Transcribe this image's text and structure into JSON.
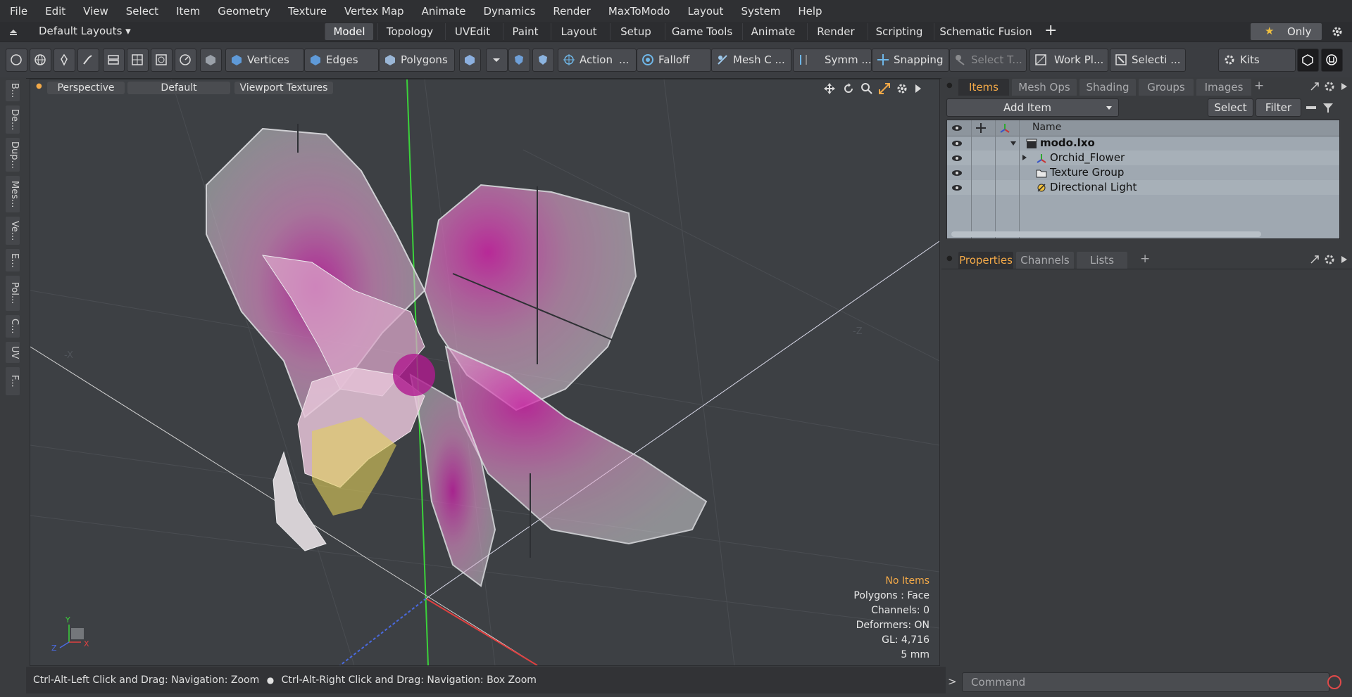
{
  "menu": [
    "File",
    "Edit",
    "View",
    "Select",
    "Item",
    "Geometry",
    "Texture",
    "Vertex Map",
    "Animate",
    "Dynamics",
    "Render",
    "MaxToModo",
    "Layout",
    "System",
    "Help"
  ],
  "layoutbar": {
    "preset": "Default Layouts ▾",
    "tabs": [
      "Model",
      "Topology",
      "UVEdit",
      "Paint",
      "Layout",
      "Setup",
      "Game Tools",
      "Animate",
      "Render",
      "Scripting",
      "Schematic Fusion"
    ],
    "add": "+",
    "only": "Only",
    "star": "★"
  },
  "toolbar": {
    "vertices": "Vertices",
    "edges": "Edges",
    "polygons": "Polygons",
    "action": "Action",
    "action_more": "...",
    "falloff": "Falloff",
    "meshc": "Mesh C ...",
    "symm": "Symm ...",
    "snapping": "Snapping",
    "selectt": "Select T...",
    "workpl": "Work Pl...",
    "selecti": "Selecti ...",
    "kits": "Kits"
  },
  "leftstrip": [
    "B...",
    "De...",
    "Dup...",
    "Mes...",
    "Ve...",
    "E...",
    "Pol...",
    "C...",
    "UV",
    "F..."
  ],
  "viewport": {
    "view_mode": "Perspective",
    "shading": "Default",
    "textures": "Viewport Textures",
    "axis_labels": {
      "neg_x": "-X",
      "neg_z": "-Z",
      "x": "X",
      "y": "Y",
      "z": "Z"
    },
    "stats": {
      "selection": "No Items",
      "polygons": "Polygons : Face",
      "channels": "Channels: 0",
      "deformers": "Deformers: ON",
      "gl": "GL: 4,716",
      "scale": "5 mm"
    }
  },
  "status": {
    "hint1": "Ctrl-Alt-Left Click and Drag: Navigation: Zoom",
    "hint2": "Ctrl-Alt-Right Click and Drag: Navigation: Box Zoom"
  },
  "items_panel": {
    "tabs": [
      "Items",
      "Mesh Ops",
      "Shading",
      "Groups",
      "Images"
    ],
    "add_tab": "+",
    "add_item": "Add Item",
    "select": "Select",
    "filter": "Filter",
    "col_name": "Name",
    "tree": [
      {
        "label": "modo.lxo",
        "bold": true
      },
      {
        "label": "Orchid_Flower"
      },
      {
        "label": "Texture Group"
      },
      {
        "label": "Directional Light"
      }
    ]
  },
  "props_panel": {
    "tabs": [
      "Properties",
      "Channels",
      "Lists"
    ],
    "add_tab": "+"
  },
  "command": {
    "prompt": ">",
    "placeholder": "Command"
  },
  "colors": {
    "accent": "#f3a948",
    "items_bg": "#9fa8b1",
    "viewport_bg": "#3d4044"
  }
}
